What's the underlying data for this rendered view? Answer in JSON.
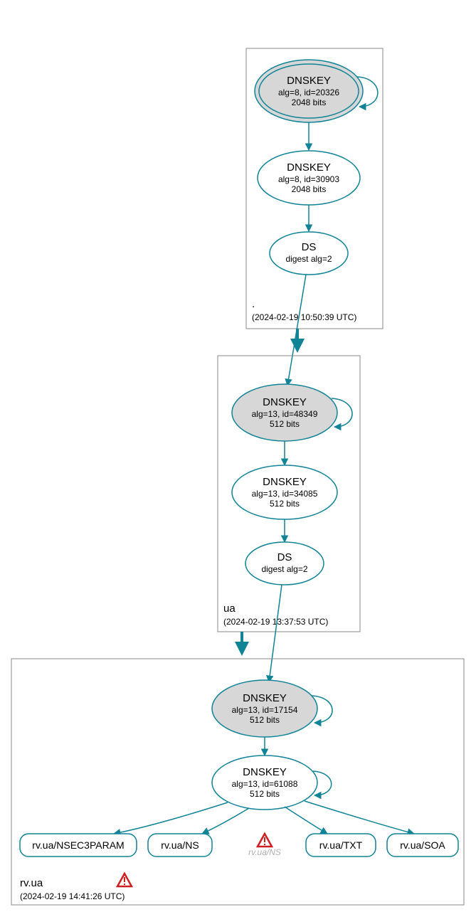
{
  "zones": {
    "root": {
      "name": ".",
      "time": "(2024-02-19 10:50:39 UTC)"
    },
    "ua": {
      "name": "ua",
      "time": "(2024-02-19 13:37:53 UTC)"
    },
    "rvua": {
      "name": "rv.ua",
      "time": "(2024-02-19 14:41:26 UTC)"
    }
  },
  "nodes": {
    "root_ksk": {
      "title": "DNSKEY",
      "l1": "alg=8, id=20326",
      "l2": "2048 bits"
    },
    "root_zsk": {
      "title": "DNSKEY",
      "l1": "alg=8, id=30903",
      "l2": "2048 bits"
    },
    "root_ds": {
      "title": "DS",
      "l1": "digest alg=2"
    },
    "ua_ksk": {
      "title": "DNSKEY",
      "l1": "alg=13, id=48349",
      "l2": "512 bits"
    },
    "ua_zsk": {
      "title": "DNSKEY",
      "l1": "alg=13, id=34085",
      "l2": "512 bits"
    },
    "ua_ds": {
      "title": "DS",
      "l1": "digest alg=2"
    },
    "rv_ksk": {
      "title": "DNSKEY",
      "l1": "alg=13, id=17154",
      "l2": "512 bits"
    },
    "rv_zsk": {
      "title": "DNSKEY",
      "l1": "alg=13, id=61088",
      "l2": "512 bits"
    }
  },
  "leaves": {
    "nsec3": "rv.ua/NSEC3PARAM",
    "ns": "rv.ua/NS",
    "ns_warn": "rv.ua/NS",
    "txt": "rv.ua/TXT",
    "soa": "rv.ua/SOA"
  }
}
